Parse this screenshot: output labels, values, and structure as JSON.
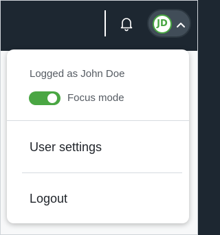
{
  "header": {
    "bell_icon": "bell-icon",
    "user": {
      "initials": "JD",
      "avatar_color": "#47a541",
      "chevron_icon": "chevron-up-icon"
    }
  },
  "menu": {
    "logged_as": "Logged as John Doe",
    "focus_mode": {
      "label": "Focus mode",
      "enabled": true,
      "color": "#4aa643"
    },
    "items": [
      {
        "label": "User settings"
      },
      {
        "label": "Logout"
      }
    ]
  }
}
